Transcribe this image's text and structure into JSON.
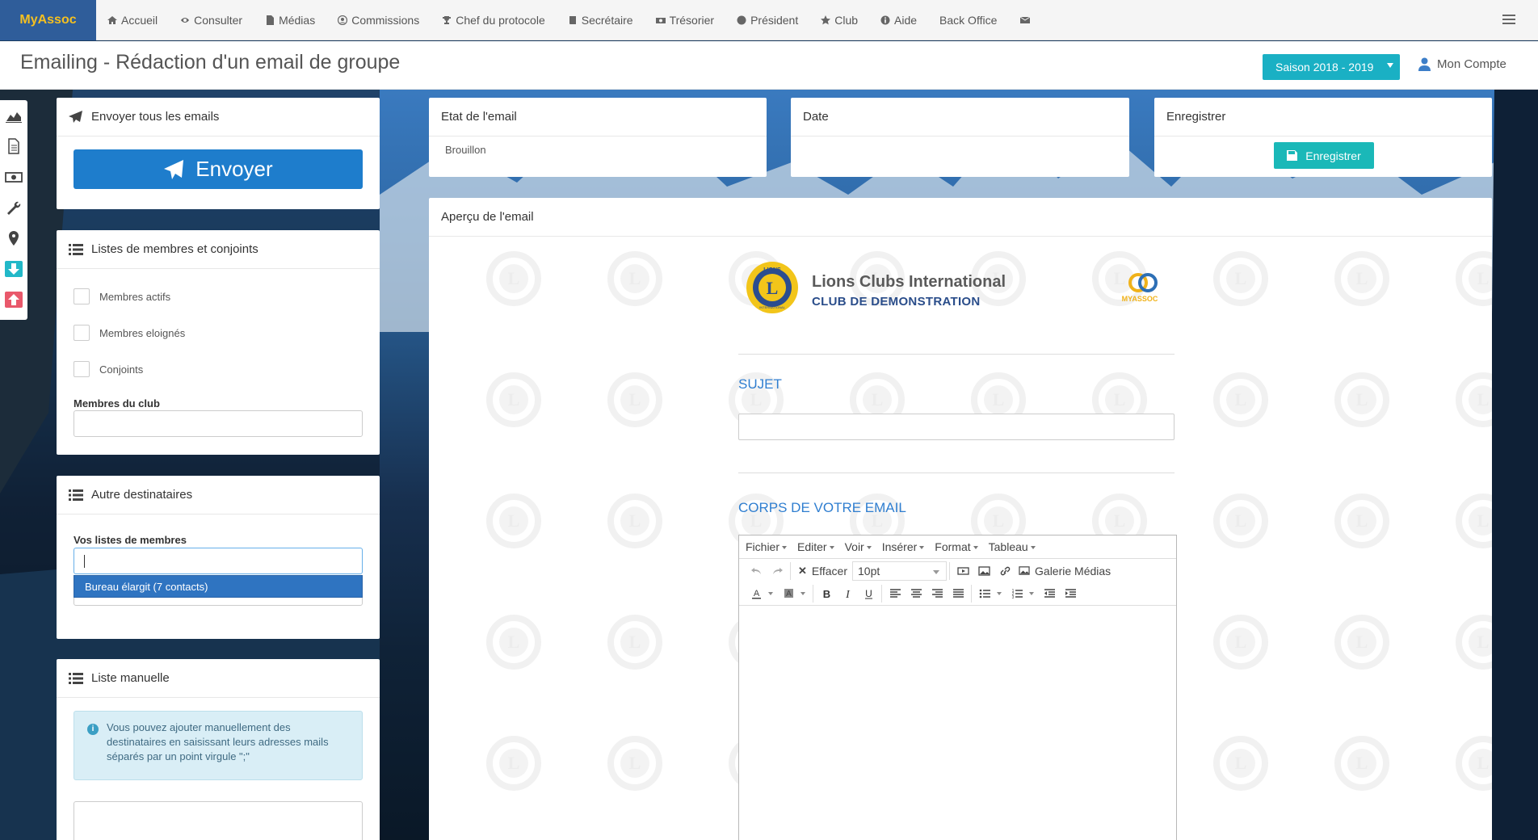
{
  "nav": {
    "brand": "MyAssoc",
    "items": [
      {
        "label": "Accueil",
        "icon": "home-icon"
      },
      {
        "label": "Consulter",
        "icon": "eye-icon"
      },
      {
        "label": "Médias",
        "icon": "file-icon"
      },
      {
        "label": "Commissions",
        "icon": "user-circle-icon"
      },
      {
        "label": "Chef du protocole",
        "icon": "trophy-icon"
      },
      {
        "label": "Secrétaire",
        "icon": "book-icon"
      },
      {
        "label": "Trésorier",
        "icon": "money-icon"
      },
      {
        "label": "Président",
        "icon": "globe-icon"
      },
      {
        "label": "Club",
        "icon": "star-icon"
      },
      {
        "label": "Aide",
        "icon": "info-icon"
      },
      {
        "label": "Back Office",
        "icon": ""
      }
    ],
    "mail_icon": "envelope-icon",
    "menu_icon": "list-icon"
  },
  "header": {
    "title": "Emailing - Rédaction d'un email de groupe",
    "season": "Saison 2018 - 2019",
    "account": "Mon Compte"
  },
  "sidebar_icons": [
    "area-chart-icon",
    "document-icon",
    "money-icon",
    "wrench-icon",
    "map-marker-icon",
    "download-icon",
    "upload-icon"
  ],
  "send_panel": {
    "title": "Envoyer tous les emails",
    "button": "Envoyer"
  },
  "lists_panel": {
    "title": "Listes de membres et conjoints",
    "checkboxes": [
      "Membres actifs",
      "Membres eloignés",
      "Conjoints"
    ],
    "members_label": "Membres du club"
  },
  "other_panel": {
    "title": "Autre destinataires",
    "lists_label": "Vos listes de membres",
    "dropdown_option": "Bureau élargit (7 contacts)"
  },
  "manual_panel": {
    "title": "Liste manuelle",
    "info": "Vous pouvez ajouter manuellement des destinataires en saisissant leurs adresses mails séparés par un point virgule \";\""
  },
  "state_panel": {
    "title": "Etat de l'email",
    "value": "Brouillon"
  },
  "date_panel": {
    "title": "Date"
  },
  "save_panel": {
    "title": "Enregistrer",
    "button": "Enregistrer"
  },
  "preview": {
    "title": "Aperçu de l'email",
    "org_name": "Lions Clubs International",
    "club_name": "CLUB DE DEMONSTRATION",
    "logo_lions_text": "LIONS",
    "logo_intl_text": "INTERNATIONAL",
    "logo_myassoc_text": "MYASSOC",
    "subject_label": "SUJET",
    "body_label": "CORPS DE VOTRE EMAIL",
    "menu": [
      "Fichier",
      "Editer",
      "Voir",
      "Insérer",
      "Format",
      "Tableau"
    ],
    "clear_label": "Effacer",
    "font_size": "10pt",
    "gallery_label": "Galerie Médias"
  },
  "colors": {
    "brand_bg": "#2f5d9a",
    "brand_text": "#f5c020",
    "season_bg": "#1ab0c4",
    "send_button": "#1e7dcc",
    "save_button": "#1ab8b8",
    "heading_blue": "#2f7ed0"
  }
}
